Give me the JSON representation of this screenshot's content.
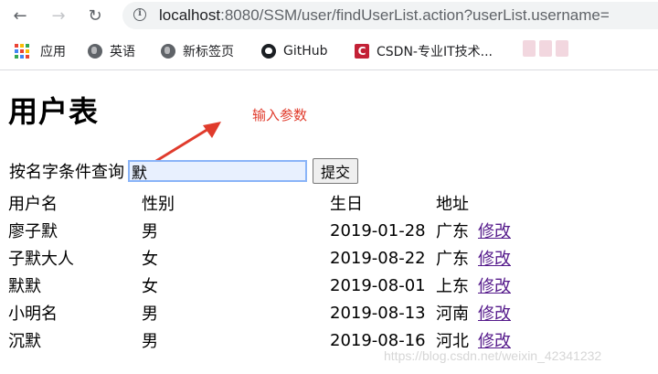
{
  "browser": {
    "url_host": "localhost",
    "url_path": ":8080/SSM/user/findUserList.action?userList.username=",
    "bookmarks": [
      {
        "label": "应用",
        "icon": "apps-icon"
      },
      {
        "label": "英语",
        "icon": "globe-icon"
      },
      {
        "label": "新标签页",
        "icon": "globe-icon"
      },
      {
        "label": "GitHub",
        "icon": "github-icon"
      },
      {
        "label": "CSDN-专业IT技术...",
        "icon": "csdn-icon"
      }
    ],
    "csdn_icon_glyph": "C"
  },
  "page": {
    "title": "用户表",
    "annotation": "输入参数",
    "search_label": "按名字条件查询",
    "search_value": "默",
    "submit_label": "提交",
    "table": {
      "headers": [
        "用户名",
        "性别",
        "生日",
        "地址"
      ],
      "rows": [
        {
          "name": "廖子默",
          "gender": "男",
          "birthday": "2019-01-28",
          "address": "广东",
          "action": "修改"
        },
        {
          "name": "子默大人",
          "gender": "女",
          "birthday": "2019-08-22",
          "address": "广东",
          "action": "修改"
        },
        {
          "name": "默默",
          "gender": "女",
          "birthday": "2019-08-01",
          "address": "上东",
          "action": "修改"
        },
        {
          "name": "小明名",
          "gender": "男",
          "birthday": "2019-08-13",
          "address": "河南",
          "action": "修改"
        },
        {
          "name": "沉默",
          "gender": "男",
          "birthday": "2019-08-16",
          "address": "河北",
          "action": "修改"
        }
      ]
    }
  },
  "watermark": "https://blog.csdn.net/weixin_42341232",
  "colors": {
    "annotation": "#e03b2c",
    "link": "#551a8b",
    "input_bg": "#e8f0fe",
    "input_border": "#8ab4f8"
  }
}
